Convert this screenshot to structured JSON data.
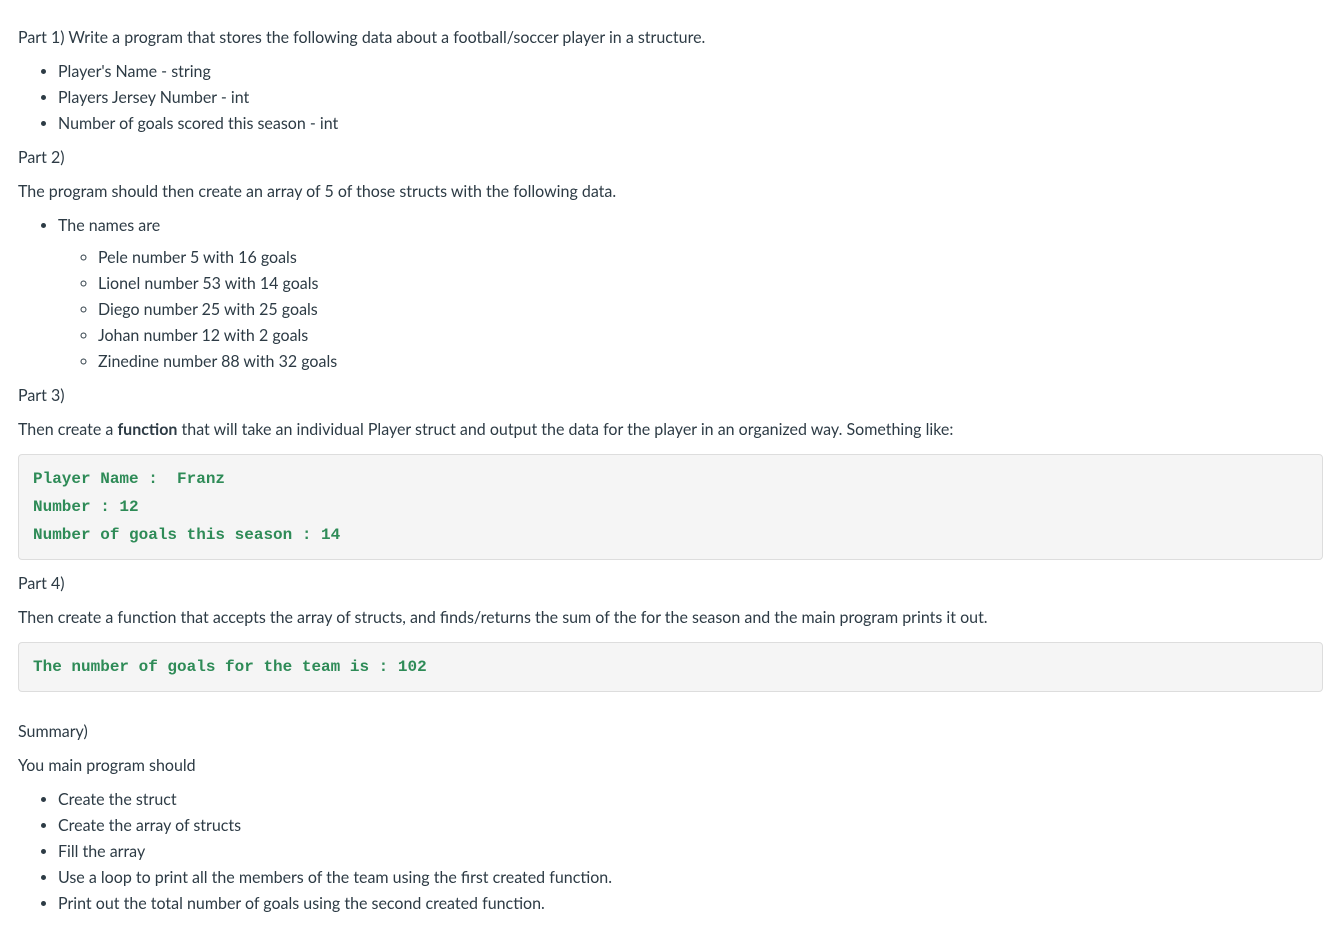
{
  "part1": {
    "intro": "Part 1)  Write a program that stores the following data about a football/soccer player in a structure.",
    "items": [
      "Player's Name - string",
      "Players Jersey Number - int",
      "Number of goals scored this season - int"
    ]
  },
  "part2": {
    "heading": "Part 2)",
    "intro": "The program should then create an array of 5 of those structs with the following data.",
    "names_label": "The names are",
    "players": [
      "Pele number 5 with 16 goals",
      "Lionel number 53 with 14 goals",
      "Diego number 25 with 25 goals",
      "Johan number 12 with 2 goals",
      "Zinedine number 88 with 32 goals"
    ]
  },
  "part3": {
    "heading": "Part 3)",
    "text_before": "Then create a ",
    "bold_word": "function",
    "text_after": " that will take an individual Player struct and output the data for the player in an organized way.   Something like:",
    "code": "Player Name :  Franz\nNumber : 12\nNumber of goals this season : 14"
  },
  "part4": {
    "heading": "Part 4)",
    "text": "Then create a function that accepts the array of structs, and finds/returns the sum of the for the season and the main program prints it out.",
    "code": "The number of goals for the team is : 102"
  },
  "summary": {
    "heading": "Summary)",
    "intro": "You main program should",
    "items": [
      "Create the struct",
      "Create the array of structs",
      "Fill the array",
      "Use a loop to print all the members of the team using the first created function.",
      "Print out the total number of goals using the second created function."
    ]
  }
}
